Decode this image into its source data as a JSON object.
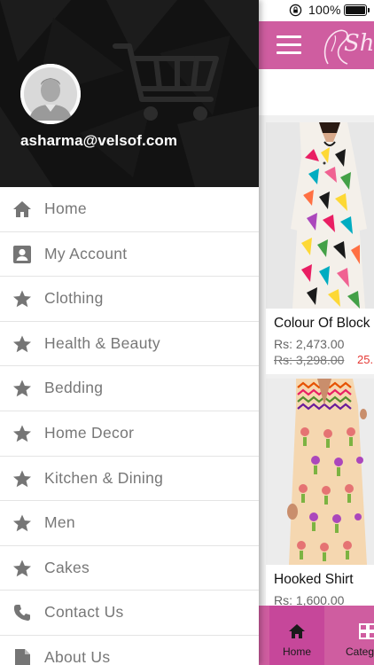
{
  "status_bar": {
    "battery_percent": "100%"
  },
  "app_bar": {
    "logo_text": "She",
    "menu_icon": "hamburger-icon"
  },
  "products": [
    {
      "title": "Colour Of Block",
      "price": "Rs: 2,473.00",
      "old_price": "Rs: 3,298.00",
      "discount": "25."
    },
    {
      "title": "Hooked Shirt",
      "price": "Rs: 1,600.00"
    }
  ],
  "bottom_nav": {
    "items": [
      {
        "label": "Home",
        "icon": "home-icon",
        "active": true
      },
      {
        "label": "Categ",
        "icon": "grid-icon",
        "active": false
      }
    ]
  },
  "drawer": {
    "user_email": "asharma@velsof.com",
    "items": [
      {
        "label": "Home",
        "icon": "home-icon"
      },
      {
        "label": "My Account",
        "icon": "account-box-icon"
      },
      {
        "label": "Clothing",
        "icon": "star-icon"
      },
      {
        "label": "Health & Beauty",
        "icon": "star-icon"
      },
      {
        "label": "Bedding",
        "icon": "star-icon"
      },
      {
        "label": "Home Decor",
        "icon": "star-icon"
      },
      {
        "label": "Kitchen & Dining",
        "icon": "star-icon"
      },
      {
        "label": "Men",
        "icon": "star-icon"
      },
      {
        "label": "Cakes",
        "icon": "star-icon"
      },
      {
        "label": "Contact Us",
        "icon": "phone-icon"
      },
      {
        "label": "About Us",
        "icon": "document-icon"
      }
    ]
  },
  "colors": {
    "brand": "#cf5da0",
    "brand_active": "#c6479a",
    "header_bg": "#121212",
    "menu_text": "#777777",
    "discount": "#e53935"
  }
}
